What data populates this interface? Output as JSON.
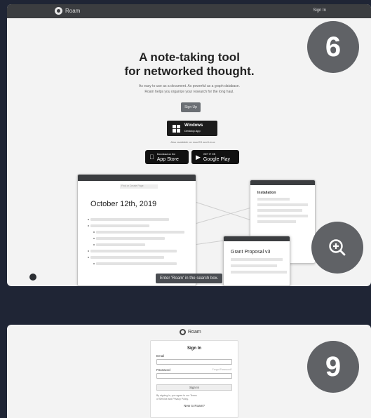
{
  "card1": {
    "brand": "Roam",
    "topbar_signin": "Sign In",
    "hero_title_line1": "A note-taking tool",
    "hero_title_line2": "for networked thought.",
    "hero_sub_line1": "As easy to use as a document. As powerful as a graph database.",
    "hero_sub_line2": "Roam helps you organize your research for the long haul.",
    "signup_label": "Sign Up",
    "windows_label": "Windows",
    "windows_sub": "Desktop App",
    "also_available": "Also available on macOS and Linux",
    "appstore_small": "Download on the",
    "appstore_label": "App Store",
    "googleplay_small": "GET IT ON",
    "googleplay_label": "Google Play",
    "preview": {
      "search_placeholder": "Find or Create Page",
      "date_title": "October 12th, 2019",
      "right_head": "Installation",
      "float_head": "Grant Proposal v3"
    },
    "tooltip": "Enter 'Roam' in the search box.",
    "step_badge": "6"
  },
  "card2": {
    "brand": "Roam",
    "signin_title": "Sign In",
    "email_label": "Email",
    "password_label": "Password",
    "forgot_password": "Forgot Password?",
    "signin_button": "Sign In",
    "note_line1": "By signing in, you agree to our Terms",
    "note_line2": "of Service and Privacy Policy.",
    "new_signup": "New to Roam?",
    "step_badge": "9"
  },
  "icons": {
    "zoom": "zoom-in-icon",
    "windows": "windows-logo-icon",
    "apple": "apple-icon",
    "play": "play-store-icon"
  },
  "colors": {
    "background": "#1f2535",
    "badge": "#606266",
    "card": "#f3f3f3"
  }
}
